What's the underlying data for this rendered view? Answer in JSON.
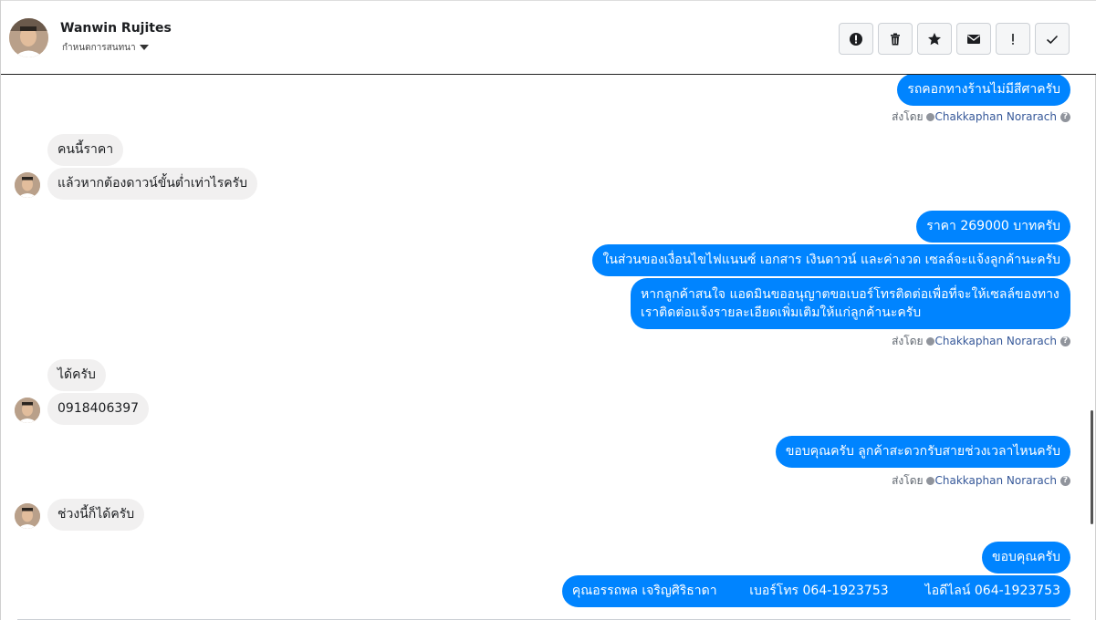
{
  "header": {
    "name": "Wanwin Rujites",
    "subtitle": "กำหนดการสนทนา",
    "tools": [
      "alert-circle-icon",
      "trash-icon",
      "star-icon",
      "envelope-icon",
      "exclamation-icon",
      "checkmark-icon"
    ]
  },
  "messages": {
    "m1": "รถคอกทางร้านไม่มีสีศาครับ",
    "sent1_label": "ส่งโดย",
    "sent1_who": "Chakkaphan Norarach",
    "m2": "คนนี้ราคา",
    "m3": "แล้วหากต้องดาวน์ขั้นต่ำเท่าไรครับ",
    "m4": "ราคา 269000 บาทครับ",
    "m5": "ในส่วนของเงื่อนไขไฟแนนซ์ เอกสาร เงินดาวน์ และค่างวด เซลล์จะแจ้งลูกค้านะครับ",
    "m6": "หากลูกค้าสนใจ แอดมินขออนุญาตขอเบอร์โทรติดต่อเพื่อที่จะให้เซลล์ของทางเราติดต่อแจ้งรายละเอียดเพิ่มเติมให้แก่ลูกค้านะครับ",
    "sent2_label": "ส่งโดย",
    "sent2_who": "Chakkaphan Norarach",
    "m7": "ได้ครับ",
    "m8": "0918406397",
    "m9": "ขอบคุณครับ ลูกค้าสะดวกรับสายช่วงเวลาไหนครับ",
    "sent3_label": "ส่งโดย",
    "sent3_who": "Chakkaphan Norarach",
    "m10": "ช่วงนี้ก็ได้ครับ",
    "m11": "ขอบคุณครับ",
    "m12": "คุณอรรถพล เจริญศิริธาดา        เบอร์โทร 064-1923753         ไอดีไลน์ 064-1923753"
  },
  "colors": {
    "outgoing": "#0084ff",
    "incoming": "#f1f0f0",
    "sender_link": "#365899"
  }
}
